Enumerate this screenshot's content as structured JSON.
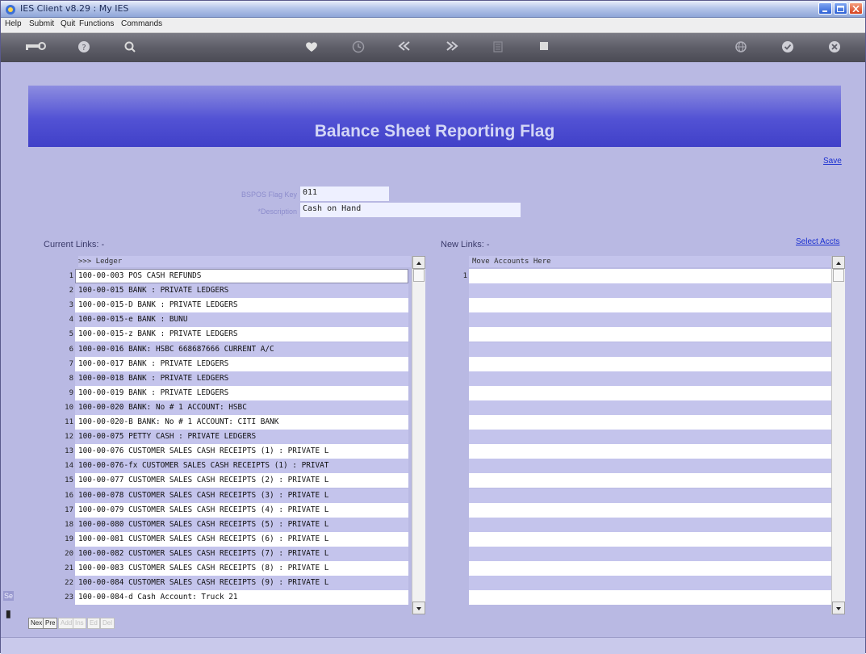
{
  "window": {
    "title": "IES Client v8.29 : My IES"
  },
  "menu": {
    "items": [
      "Help",
      "Submit",
      "Quit",
      "Functions",
      "Commands"
    ]
  },
  "toolbar": {
    "icons": [
      "key-icon",
      "help-icon",
      "search-icon",
      "heart-icon",
      "clock-icon",
      "rewind-icon",
      "fast-forward-icon",
      "list-icon",
      "stop-icon",
      "globe-icon",
      "check-icon",
      "close-icon"
    ]
  },
  "page": {
    "title": "Balance Sheet Reporting Flag",
    "save_label": "Save",
    "flag_key_label": "BSPOS Flag Key",
    "flag_key_value": "011",
    "description_label": "*Description",
    "description_value": "Cash on Hand"
  },
  "current_links": {
    "title": "Current Links: -",
    "header": ">>> Ledger",
    "rows": [
      "100-00-003 POS CASH REFUNDS",
      "100-00-015 BANK : PRIVATE LEDGERS",
      "100-00-015-D BANK : PRIVATE LEDGERS",
      "100-00-015-e BANK : BUNU",
      "100-00-015-z BANK : PRIVATE LEDGERS",
      "100-00-016 BANK: HSBC 668687666 CURRENT A/C",
      "100-00-017 BANK : PRIVATE LEDGERS",
      "100-00-018 BANK : PRIVATE LEDGERS",
      "100-00-019 BANK : PRIVATE LEDGERS",
      "100-00-020 BANK: No # 1 ACCOUNT: HSBC",
      "100-00-020-B BANK: No # 1 ACCOUNT: CITI BANK",
      "100-00-075 PETTY CASH : PRIVATE LEDGERS",
      "100-00-076 CUSTOMER SALES CASH RECEIPTS (1) : PRIVATE L",
      "100-00-076-fx CUSTOMER SALES CASH RECEIPTS (1) : PRIVAT",
      "100-00-077 CUSTOMER SALES CASH RECEIPTS (2) : PRIVATE L",
      "100-00-078 CUSTOMER SALES CASH RECEIPTS (3) : PRIVATE L",
      "100-00-079 CUSTOMER SALES CASH RECEIPTS (4) : PRIVATE L",
      "100-00-080 CUSTOMER SALES CASH RECEIPTS (5) : PRIVATE L",
      "100-00-081 CUSTOMER SALES CASH RECEIPTS (6) : PRIVATE L",
      "100-00-082 CUSTOMER SALES CASH RECEIPTS (7) : PRIVATE L",
      "100-00-083 CUSTOMER SALES CASH RECEIPTS (8) : PRIVATE L",
      "100-00-084 CUSTOMER SALES CASH RECEIPTS (9) : PRIVATE L",
      "100-00-084-d Cash Account: Truck 21"
    ]
  },
  "new_links": {
    "title": "New Links: -",
    "select_label": "Select Accts",
    "header": "Move Accounts Here",
    "first_row_number": "1"
  },
  "nav_buttons": [
    {
      "label": "Nex",
      "enabled": true
    },
    {
      "label": "Pre",
      "enabled": true
    },
    {
      "label": "Add",
      "enabled": false
    },
    {
      "label": "Ins",
      "enabled": false
    },
    {
      "label": "Ed",
      "enabled": false
    },
    {
      "label": "Del",
      "enabled": false
    }
  ],
  "side_fragment": "Se",
  "colors": {
    "background": "#b9b9e3",
    "banner": "#4a4ad0",
    "link": "#1a2fd0",
    "row_alt": "#c4c4ec"
  }
}
